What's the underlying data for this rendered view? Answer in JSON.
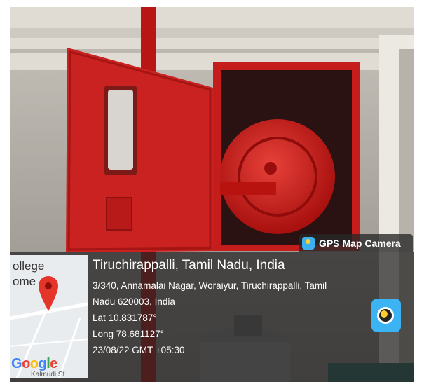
{
  "photo": {
    "subject": "wall-mounted fire hose reel cabinet"
  },
  "badge": {
    "label": "GPS Map Camera",
    "icon": "gps-map-camera-icon"
  },
  "map": {
    "line1": "ollege",
    "line2": "ome",
    "logo": "Google",
    "street": "Kalmudi St"
  },
  "location": {
    "title": "Tiruchirappalli, Tamil Nadu, India",
    "address_line1": "3/340, Annamalai Nagar, Woraiyur, Tiruchirappalli, Tamil",
    "address_line2": "Nadu 620003, India",
    "lat": "Lat 10.831787°",
    "long": "Long 78.681127°",
    "datetime": "23/08/22 GMT +05:30"
  },
  "colors": {
    "cabinet_red": "#c9201f",
    "overlay": "#232323",
    "app_blue": "#3db0f0"
  }
}
